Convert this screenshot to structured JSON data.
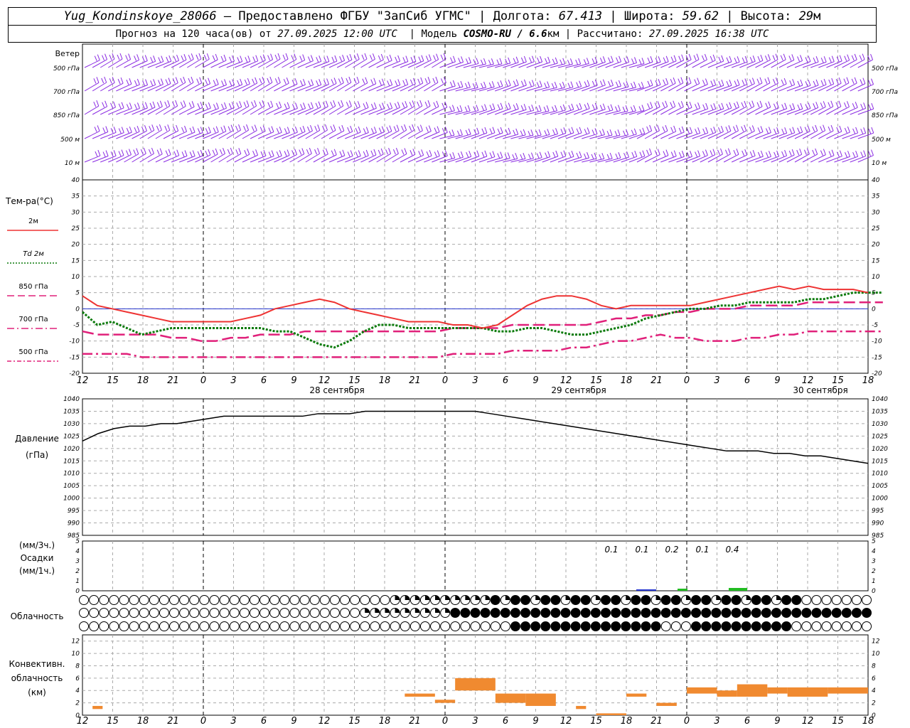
{
  "header": {
    "station": "Yug_Kondinskoye_28066",
    "provided_by": "– Предоставлено ФГБУ \"ЗапСиб УГМС\"",
    "lon_label": "Долгота:",
    "lon": "67.413",
    "lat_label": "Широта:",
    "lat": "59.62",
    "alt_label": "Высота:",
    "alt": "29",
    "alt_unit": "м",
    "forecast_label": "Прогноз на 120 часа(ов) от",
    "forecast_time": "27.09.2025 12:00 UTC",
    "model_label": "Модель",
    "model": "COSMO-RU / 6.6",
    "model_unit": "км",
    "computed_label": "Рассчитано:",
    "computed_time": "27.09.2025 16:38 UTC"
  },
  "colors": {
    "wind": "#8a2be2",
    "t2m": "#ee3333",
    "td2m": "#0a7a0a",
    "t850": "#e0207a",
    "pressure": "#000000",
    "precip_blue": "#2233cc",
    "precip_green": "#22bb22",
    "convective": "#f08a30",
    "grid": "#aaaaaa"
  },
  "time_axis": {
    "hour_ticks": [
      "12",
      "15",
      "18",
      "21",
      "0",
      "3",
      "6",
      "9",
      "12",
      "15",
      "18",
      "21",
      "0",
      "3",
      "6",
      "9",
      "12",
      "15",
      "18",
      "21",
      "0",
      "3",
      "6",
      "9",
      "12",
      "15",
      "18"
    ],
    "dates": [
      "28 сентября",
      "29 сентября",
      "30 сентября"
    ]
  },
  "chart_data": [
    {
      "type": "wind_barbs",
      "title": "Ветер",
      "levels": [
        "500 гПа",
        "700 гПа",
        "850 гПа",
        "500 м",
        "10 м"
      ]
    },
    {
      "type": "line",
      "title": "Тем-ра(°C)",
      "ylim": [
        -20,
        40
      ],
      "yticks": [
        "40",
        "35",
        "30",
        "25",
        "20",
        "15",
        "10",
        "5",
        "0",
        "-5",
        "-10",
        "-15",
        "-20"
      ],
      "series": [
        {
          "name": "2м",
          "style": "solid",
          "values": [
            4,
            1,
            0,
            -1,
            -2,
            -3,
            -4,
            -4,
            -4,
            -4,
            -4,
            -3,
            -2,
            0,
            1,
            2,
            3,
            2,
            0,
            -1,
            -2,
            -3,
            -4,
            -4,
            -4,
            -5,
            -5,
            -6,
            -5,
            -2,
            1,
            3,
            4,
            4,
            3,
            1,
            0,
            1,
            1,
            1,
            1,
            1,
            2,
            3,
            4,
            5,
            6,
            7,
            6,
            7,
            6,
            6,
            6,
            5
          ]
        },
        {
          "name": "Td 2м",
          "style": "dotted",
          "values": [
            -1,
            -5,
            -4,
            -6,
            -8,
            -7,
            -6,
            -6,
            -6,
            -6,
            -6,
            -6,
            -6,
            -7,
            -7,
            -9,
            -11,
            -12,
            -10,
            -7,
            -5,
            -5,
            -6,
            -6,
            -6,
            -6,
            -6,
            -6,
            -7,
            -7,
            -6,
            -6,
            -7,
            -8,
            -8,
            -7,
            -6,
            -5,
            -3,
            -2,
            -1,
            0,
            0,
            1,
            1,
            2,
            2,
            2,
            2,
            3,
            3,
            4,
            5,
            5,
            5
          ]
        },
        {
          "name": "850 гПа",
          "style": "dashed",
          "values": [
            -7,
            -8,
            -8,
            -8,
            -8,
            -8,
            -9,
            -9,
            -10,
            -10,
            -9,
            -9,
            -8,
            -8,
            -8,
            -7,
            -7,
            -7,
            -7,
            -7,
            -7,
            -7,
            -7,
            -7,
            -7,
            -6,
            -6,
            -6,
            -6,
            -5,
            -5,
            -5,
            -5,
            -5,
            -5,
            -4,
            -3,
            -3,
            -2,
            -2,
            -1,
            -1,
            0,
            0,
            0,
            1,
            1,
            1,
            1,
            2,
            2,
            2,
            2,
            2,
            2
          ]
        },
        {
          "name": "700 гПа",
          "style": "dashdot",
          "values": []
        },
        {
          "name": "500 гПа",
          "style": "dashdot2",
          "values": [
            -14,
            -14,
            -14,
            -14,
            -15,
            -15,
            -15,
            -15,
            -15,
            -15,
            -15,
            -15,
            -15,
            -15,
            -15,
            -15,
            -15,
            -15,
            -15,
            -15,
            -15,
            -15,
            -15,
            -15,
            -15,
            -14,
            -14,
            -14,
            -14,
            -13,
            -13,
            -13,
            -13,
            -12,
            -12,
            -11,
            -10,
            -10,
            -9,
            -8,
            -9,
            -9,
            -10,
            -10,
            -10,
            -9,
            -9,
            -8,
            -8,
            -7,
            -7,
            -7,
            -7,
            -7,
            -7
          ]
        }
      ]
    },
    {
      "type": "line",
      "title": "Давление",
      "unit": "(гПа)",
      "ylim": [
        985,
        1040
      ],
      "yticks": [
        "1040",
        "1035",
        "1030",
        "1025",
        "1020",
        "1015",
        "1010",
        "1005",
        "1000",
        "995",
        "990",
        "985"
      ],
      "series": [
        {
          "name": "",
          "values": [
            1023,
            1026,
            1028,
            1029,
            1029,
            1030,
            1030,
            1031,
            1032,
            1033,
            1033,
            1033,
            1033,
            1033,
            1033,
            1034,
            1034,
            1034,
            1035,
            1035,
            1035,
            1035,
            1035,
            1035,
            1035,
            1035,
            1034,
            1033,
            1032,
            1031,
            1030,
            1029,
            1028,
            1027,
            1026,
            1025,
            1024,
            1023,
            1022,
            1021,
            1020,
            1019,
            1019,
            1019,
            1018,
            1018,
            1017,
            1017,
            1016,
            1015,
            1014
          ]
        }
      ]
    },
    {
      "type": "bar",
      "title": "Осадки",
      "units": [
        "(мм/3ч.)",
        "(мм/1ч.)"
      ],
      "yticks": [
        "5",
        "4",
        "3",
        "2",
        "1",
        "0"
      ],
      "labels": [
        "0.1",
        "0.1",
        "0.2",
        "0.1",
        "0.4"
      ]
    },
    {
      "type": "table",
      "title": "Облачность",
      "rows": 3
    },
    {
      "type": "bar",
      "title": "Конвективн.",
      "title2": "облачность",
      "unit": "(км)",
      "yticks": [
        "12",
        "10",
        "8",
        "6",
        "4",
        "2",
        "0"
      ],
      "bars": [
        {
          "start": 1,
          "end": 2,
          "bottom": 1,
          "top": 1.5
        },
        {
          "start": 32,
          "end": 35,
          "bottom": 3,
          "top": 3.5
        },
        {
          "start": 35,
          "end": 37,
          "bottom": 2,
          "top": 2.5
        },
        {
          "start": 37,
          "end": 41,
          "bottom": 4,
          "top": 6
        },
        {
          "start": 41,
          "end": 44,
          "bottom": 2,
          "top": 3.5
        },
        {
          "start": 44,
          "end": 47,
          "bottom": 1.5,
          "top": 3.5
        },
        {
          "start": 49,
          "end": 50,
          "bottom": 1,
          "top": 1.5
        },
        {
          "start": 51,
          "end": 54,
          "bottom": 0,
          "top": 0.3
        },
        {
          "start": 54,
          "end": 56,
          "bottom": 3,
          "top": 3.5
        },
        {
          "start": 57,
          "end": 59,
          "bottom": 1.5,
          "top": 2
        },
        {
          "start": 60,
          "end": 63,
          "bottom": 3.5,
          "top": 4.5
        },
        {
          "start": 63,
          "end": 65,
          "bottom": 3,
          "top": 4
        },
        {
          "start": 65,
          "end": 68,
          "bottom": 3,
          "top": 5
        },
        {
          "start": 68,
          "end": 70,
          "bottom": 3.5,
          "top": 4.5
        },
        {
          "start": 70,
          "end": 72,
          "bottom": 3,
          "top": 4.5
        },
        {
          "start": 72,
          "end": 74,
          "bottom": 3,
          "top": 4.5
        },
        {
          "start": 74,
          "end": 78,
          "bottom": 3.5,
          "top": 4.5
        }
      ]
    }
  ]
}
